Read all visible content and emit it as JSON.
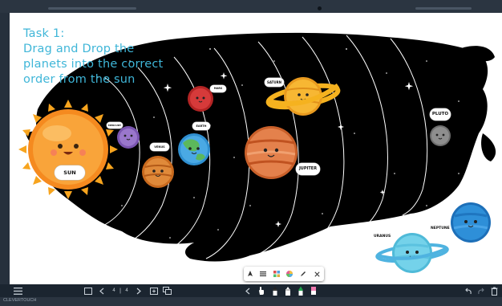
{
  "task": {
    "title": "Task 1:\nDrag and Drop the\nplanets into the correct\norder from the sun"
  },
  "labels": {
    "sun": "SUN",
    "mercury": "MERCURY",
    "venus": "VENUS",
    "earth": "EARTH",
    "mars": "MARS",
    "jupiter": "JUPITER",
    "saturn": "SATURN",
    "pluto": "PLUTO",
    "uranus": "URANUS",
    "neptune": "NEPTUNE"
  },
  "pager": {
    "current": "4",
    "total": "4"
  },
  "status": {
    "text": "CLEVERTOUCH"
  },
  "icons": {
    "floating_toolbar": [
      "pointer-icon",
      "list-icon",
      "grid-icon",
      "color-wheel-icon",
      "pen-icon",
      "close-icon"
    ],
    "bottom_bar": [
      "menu-icon",
      "page-icon",
      "prev-icon",
      "next-icon",
      "add-page-icon",
      "page-overview-icon",
      "collapse-icon",
      "hand-icon",
      "pen-black-icon",
      "highlighter-icon",
      "pen-green-icon",
      "eraser-icon",
      "undo-icon",
      "redo-icon",
      "trash-icon"
    ]
  },
  "colors": {
    "title": "#3fb6d8",
    "space": "#000000",
    "sun": "#f7931e",
    "jupiter": "#e07a4a",
    "saturn": "#f7b733",
    "earth": "#3aa0d8",
    "neptune": "#2e8fd8",
    "uranus": "#6fd0e8"
  }
}
